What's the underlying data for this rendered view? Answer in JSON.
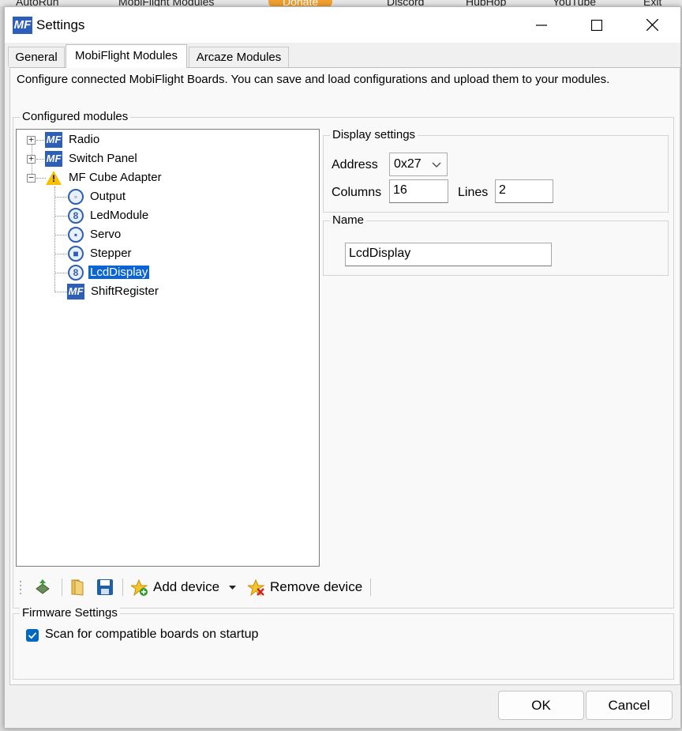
{
  "background_tabs": {
    "items": [
      "AutoRun",
      "MobiFlight Modules",
      "Donate",
      "Discord",
      "HubHop",
      "YouTube",
      "Exit"
    ]
  },
  "window": {
    "title": "Settings",
    "logo_text": "MF"
  },
  "tabs": [
    {
      "label": "General",
      "active": false
    },
    {
      "label": "MobiFlight Modules",
      "active": true
    },
    {
      "label": "Arcaze Modules",
      "active": false
    }
  ],
  "description": "Configure connected MobiFlight Boards. You can save and load configurations and upload them to your modules.",
  "configured_modules": {
    "group_label": "Configured modules",
    "tree": {
      "nodes": [
        {
          "label": "Radio",
          "icon": "mf-logo",
          "expanded": false
        },
        {
          "label": "Switch Panel",
          "icon": "mf-logo",
          "expanded": false
        },
        {
          "label": "MF Cube Adapter",
          "icon": "warning-icon",
          "expanded": true
        },
        {
          "label": "Output",
          "icon": "output-icon"
        },
        {
          "label": "LedModule",
          "icon": "ledmodule-icon"
        },
        {
          "label": "Servo",
          "icon": "servo-icon"
        },
        {
          "label": "Stepper",
          "icon": "stepper-icon"
        },
        {
          "label": "LcdDisplay",
          "icon": "lcddisplay-icon",
          "selected": true
        },
        {
          "label": "ShiftRegister",
          "icon": "mf-logo"
        }
      ]
    }
  },
  "display_settings": {
    "group_label": "Display settings",
    "address_label": "Address",
    "address_value": "0x27",
    "columns_label": "Columns",
    "columns_value": "16",
    "lines_label": "Lines",
    "lines_value": "2"
  },
  "name_group": {
    "group_label": "Name",
    "value": "LcdDisplay"
  },
  "toolbar": {
    "add_device_label": "Add device",
    "remove_device_label": "Remove device"
  },
  "firmware": {
    "group_label": "Firmware Settings",
    "scan_label": "Scan for compatible boards on startup",
    "scan_checked": true
  },
  "buttons": {
    "ok": "OK",
    "cancel": "Cancel"
  },
  "colors": {
    "accent": "#0067c0",
    "selection": "#0a64d8",
    "mf_logo": "#2e5fb8"
  }
}
